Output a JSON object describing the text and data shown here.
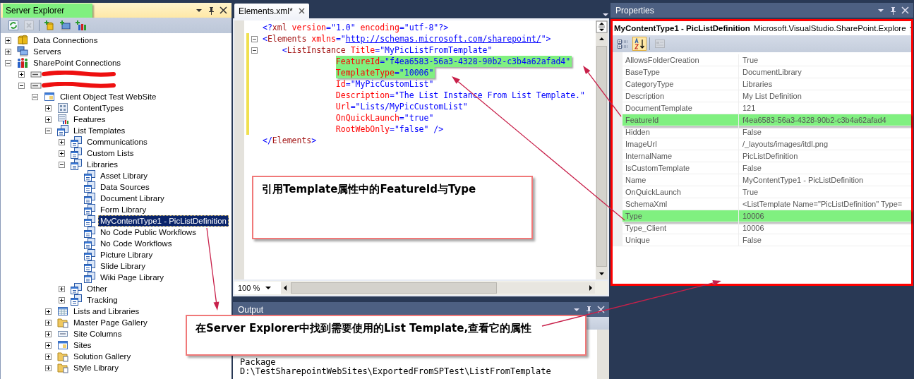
{
  "explorer": {
    "title": "Server Explorer",
    "highlighted": true,
    "toolbar": [
      {
        "kind": "refresh",
        "disabled": false
      },
      {
        "kind": "delete",
        "disabled": true
      },
      {
        "kind": "add-database",
        "disabled": false
      },
      {
        "kind": "add-server",
        "disabled": false
      },
      {
        "kind": "add-sharepoint",
        "disabled": false
      }
    ],
    "tree": [
      {
        "label": "Data Connections",
        "kind": "database",
        "expanded": false,
        "selected": false
      },
      {
        "label": "Servers",
        "kind": "servers",
        "expanded": false,
        "selected": false
      },
      {
        "label": "SharePoint Connections",
        "kind": "sharepoint",
        "expanded": true,
        "selected": false,
        "children": [
          {
            "kind": "redacted",
            "expanded": false
          },
          {
            "kind": "redacted",
            "expanded": true,
            "children": [
              {
                "label": "Client Object Test WebSite",
                "kind": "site",
                "expanded": true,
                "selected": false,
                "children": [
                  {
                    "label": "ContentTypes",
                    "kind": "content-types",
                    "expanded": false,
                    "selected": false
                  },
                  {
                    "label": "Features",
                    "kind": "features",
                    "expanded": false,
                    "selected": false
                  },
                  {
                    "label": "List Templates",
                    "kind": "template",
                    "expanded": true,
                    "selected": false,
                    "children": [
                      {
                        "label": "Communications",
                        "kind": "template",
                        "expanded": false,
                        "selected": false
                      },
                      {
                        "label": "Custom Lists",
                        "kind": "template",
                        "expanded": false,
                        "selected": false
                      },
                      {
                        "label": "Libraries",
                        "kind": "template",
                        "expanded": true,
                        "selected": false,
                        "children": [
                          {
                            "label": "Asset Library",
                            "kind": "template",
                            "selected": false
                          },
                          {
                            "label": "Data Sources",
                            "kind": "template",
                            "selected": false
                          },
                          {
                            "label": "Document Library",
                            "kind": "template",
                            "selected": false
                          },
                          {
                            "label": "Form Library",
                            "kind": "template",
                            "selected": false
                          },
                          {
                            "label": "MyContentType1 - PicListDefinition",
                            "kind": "template",
                            "selected": true
                          },
                          {
                            "label": "No Code Public Workflows",
                            "kind": "template",
                            "selected": false
                          },
                          {
                            "label": "No Code Workflows",
                            "kind": "template",
                            "selected": false
                          },
                          {
                            "label": "Picture Library",
                            "kind": "template",
                            "selected": false
                          },
                          {
                            "label": "Slide Library",
                            "kind": "template",
                            "selected": false
                          },
                          {
                            "label": "Wiki Page Library",
                            "kind": "template",
                            "selected": false
                          }
                        ]
                      },
                      {
                        "label": "Other",
                        "kind": "template",
                        "expanded": false,
                        "selected": false
                      },
                      {
                        "label": "Tracking",
                        "kind": "template",
                        "expanded": false,
                        "selected": false
                      }
                    ]
                  },
                  {
                    "label": "Lists and Libraries",
                    "kind": "list",
                    "expanded": false,
                    "selected": false
                  },
                  {
                    "label": "Master Page Gallery",
                    "kind": "gallery",
                    "expanded": false,
                    "selected": false
                  },
                  {
                    "label": "Site Columns",
                    "kind": "columns",
                    "expanded": false,
                    "selected": false
                  },
                  {
                    "label": "Sites",
                    "kind": "site",
                    "expanded": false,
                    "selected": false
                  },
                  {
                    "label": "Solution Gallery",
                    "kind": "gallery",
                    "expanded": false,
                    "selected": false
                  },
                  {
                    "label": "Style Library",
                    "kind": "gallery",
                    "expanded": false,
                    "selected": false
                  }
                ]
              }
            ]
          }
        ]
      }
    ]
  },
  "editor": {
    "tab": {
      "label": "Elements.xml*"
    },
    "zoom": "100 %",
    "lines": [
      {
        "kind": "declaration",
        "fold": false,
        "changed": false,
        "highlighted": false,
        "segments": [
          {
            "kind": "punct",
            "text": "<?"
          },
          {
            "kind": "tag",
            "text": "xml"
          },
          {
            "kind": "attr",
            "text": " version"
          },
          {
            "kind": "punct",
            "text": "=\"1.0\""
          },
          {
            "kind": "attr",
            "text": " encoding"
          },
          {
            "kind": "punct",
            "text": "=\"utf-8\"?>"
          }
        ]
      },
      {
        "kind": "root",
        "fold": true,
        "changed": true,
        "highlighted": false,
        "segments": [
          {
            "kind": "punct",
            "text": "<"
          },
          {
            "kind": "tag",
            "text": "Elements"
          },
          {
            "kind": "attr",
            "text": " xmlns"
          },
          {
            "kind": "punct",
            "text": "=\""
          },
          {
            "kind": "link",
            "text": "http://schemas.microsoft.com/sharepoint/"
          },
          {
            "kind": "punct",
            "text": "\">"
          }
        ]
      },
      {
        "kind": "child",
        "fold": true,
        "changed": true,
        "highlighted": false,
        "segments": [
          {
            "kind": "punct",
            "text": "<"
          },
          {
            "kind": "tag",
            "text": "ListInstance"
          },
          {
            "kind": "attr",
            "text": " Title"
          },
          {
            "kind": "punct",
            "text": "=\"MyPicListFromTemplate\""
          }
        ]
      },
      {
        "kind": "attribute",
        "fold": false,
        "changed": true,
        "highlighted": true,
        "segments": [
          {
            "kind": "attr",
            "text": "FeatureId"
          },
          {
            "kind": "punct",
            "text": "=\"f4ea6583-56a3-4328-90b2-c3b4a62afad4\""
          }
        ]
      },
      {
        "kind": "attribute",
        "fold": false,
        "changed": true,
        "highlighted": true,
        "segments": [
          {
            "kind": "attr",
            "text": "TemplateType"
          },
          {
            "kind": "punct",
            "text": "=\"10006\""
          }
        ]
      },
      {
        "kind": "attribute",
        "fold": false,
        "changed": true,
        "highlighted": false,
        "segments": [
          {
            "kind": "attr",
            "text": "Id"
          },
          {
            "kind": "punct",
            "text": "=\"MyPicCustomList\""
          }
        ]
      },
      {
        "kind": "attribute",
        "fold": false,
        "changed": true,
        "highlighted": false,
        "segments": [
          {
            "kind": "attr",
            "text": "Description"
          },
          {
            "kind": "punct",
            "text": "=\"The List Instance From List Template.\""
          }
        ]
      },
      {
        "kind": "attribute",
        "fold": false,
        "changed": true,
        "highlighted": false,
        "segments": [
          {
            "kind": "attr",
            "text": "Url"
          },
          {
            "kind": "punct",
            "text": "=\"Lists/MyPicCustomList\""
          }
        ]
      },
      {
        "kind": "attribute",
        "fold": false,
        "changed": true,
        "highlighted": false,
        "segments": [
          {
            "kind": "attr",
            "text": "OnQuickLaunch"
          },
          {
            "kind": "punct",
            "text": "=\"true\""
          }
        ]
      },
      {
        "kind": "attribute",
        "fold": false,
        "changed": true,
        "highlighted": false,
        "segments": [
          {
            "kind": "attr",
            "text": "RootWebOnly"
          },
          {
            "kind": "punct",
            "text": "=\"false\" />"
          }
        ]
      },
      {
        "kind": "root",
        "fold": false,
        "changed": false,
        "highlighted": false,
        "segments": [
          {
            "kind": "punct",
            "text": "</"
          },
          {
            "kind": "tag",
            "text": "Elements"
          },
          {
            "kind": "punct",
            "text": ">"
          }
        ]
      }
    ]
  },
  "output": {
    "title": "Output",
    "lines": [
      "Package",
      "D:\\TestSharepointWebSites\\ExportedFromSPTest\\ListFromTemplate"
    ]
  },
  "properties": {
    "title": "Properties",
    "outlined": true,
    "object_name": "MyContentType1 - PicListDefinition",
    "object_type": "Microsoft.VisualStudio.SharePoint.Explore",
    "toolbar": [
      {
        "kind": "categorized",
        "selected": false,
        "disabled": false
      },
      {
        "kind": "alphabetical",
        "selected": true,
        "disabled": false
      },
      {
        "kind": "property-pages",
        "selected": false,
        "disabled": true
      }
    ],
    "rows": [
      {
        "name": "AllowsFolderCreation",
        "value": "True",
        "highlighted": false
      },
      {
        "name": "BaseType",
        "value": "DocumentLibrary",
        "highlighted": false
      },
      {
        "name": "CategoryType",
        "value": "Libraries",
        "highlighted": false
      },
      {
        "name": "Description",
        "value": "My List Definition",
        "highlighted": false
      },
      {
        "name": "DocumentTemplate",
        "value": "121",
        "highlighted": false
      },
      {
        "name": "FeatureId",
        "value": "f4ea6583-56a3-4328-90b2-c3b4a62afad4",
        "highlighted": true
      },
      {
        "name": "Hidden",
        "value": "False",
        "highlighted": false
      },
      {
        "name": "ImageUrl",
        "value": "/_layouts/images/itdl.png",
        "highlighted": false
      },
      {
        "name": "InternalName",
        "value": "PicListDefinition",
        "highlighted": false
      },
      {
        "name": "IsCustomTemplate",
        "value": "False",
        "highlighted": false
      },
      {
        "name": "Name",
        "value": "MyContentType1 - PicListDefinition",
        "highlighted": false
      },
      {
        "name": "OnQuickLaunch",
        "value": "True",
        "highlighted": false
      },
      {
        "name": "SchemaXml",
        "value": "<ListTemplate Name=\"PicListDefinition\" Type=",
        "highlighted": false
      },
      {
        "name": "Type",
        "value": "10006",
        "highlighted": true
      },
      {
        "name": "Type_Client",
        "value": "10006",
        "highlighted": false
      },
      {
        "name": "Unique",
        "value": "False",
        "highlighted": false
      }
    ]
  },
  "annotations": [
    {
      "text": "引用Template属性中的FeatureId与Type"
    },
    {
      "text": "在Server Explorer中找到需要使用的List Template,查看它的属性"
    }
  ]
}
